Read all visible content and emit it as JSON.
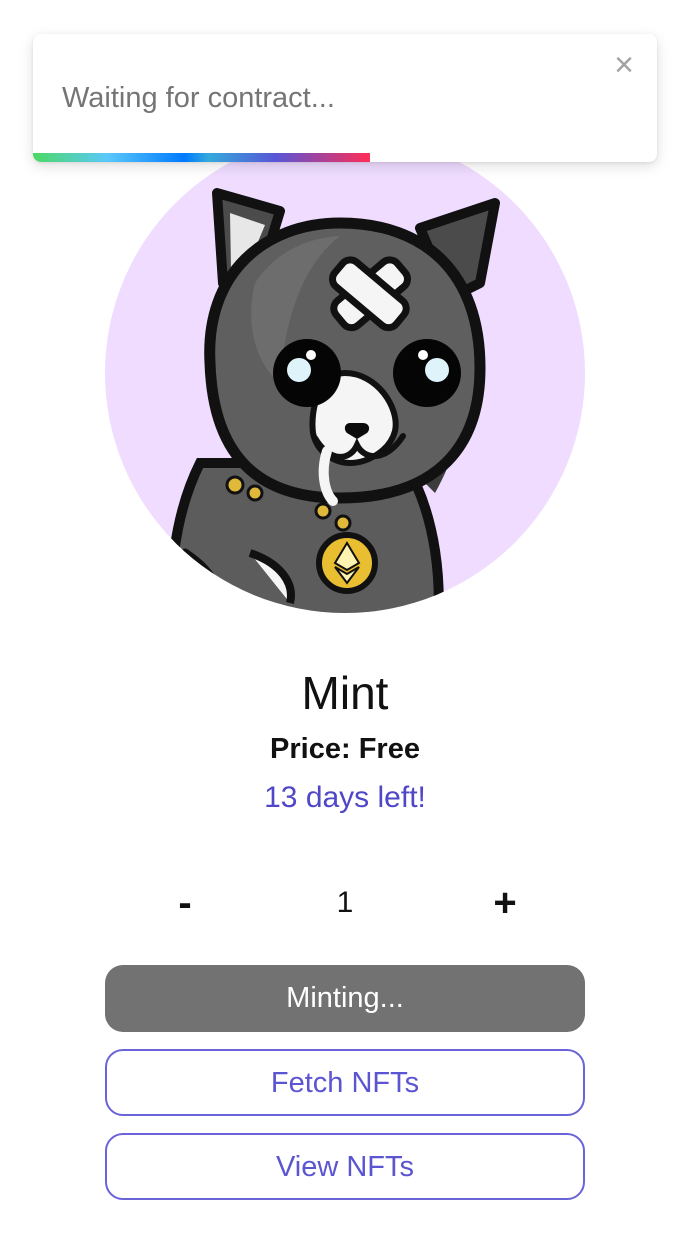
{
  "toast": {
    "message": "Waiting for contract...",
    "close_symbol": "×",
    "progress": 0.54
  },
  "nft": {
    "image_icon": "cat-nft-avatar-icon",
    "title": "Mint",
    "price": "Price: Free",
    "days_left": "13 days left!"
  },
  "quantity": {
    "minus": "-",
    "value": "1",
    "plus": "+"
  },
  "buttons": {
    "mint": "Minting...",
    "fetch": "Fetch NFTs",
    "view": "View NFTs"
  },
  "colors": {
    "accent": "#5b55d2",
    "avatar_bg": "#efdcff",
    "mint_button_bg": "#727272"
  }
}
